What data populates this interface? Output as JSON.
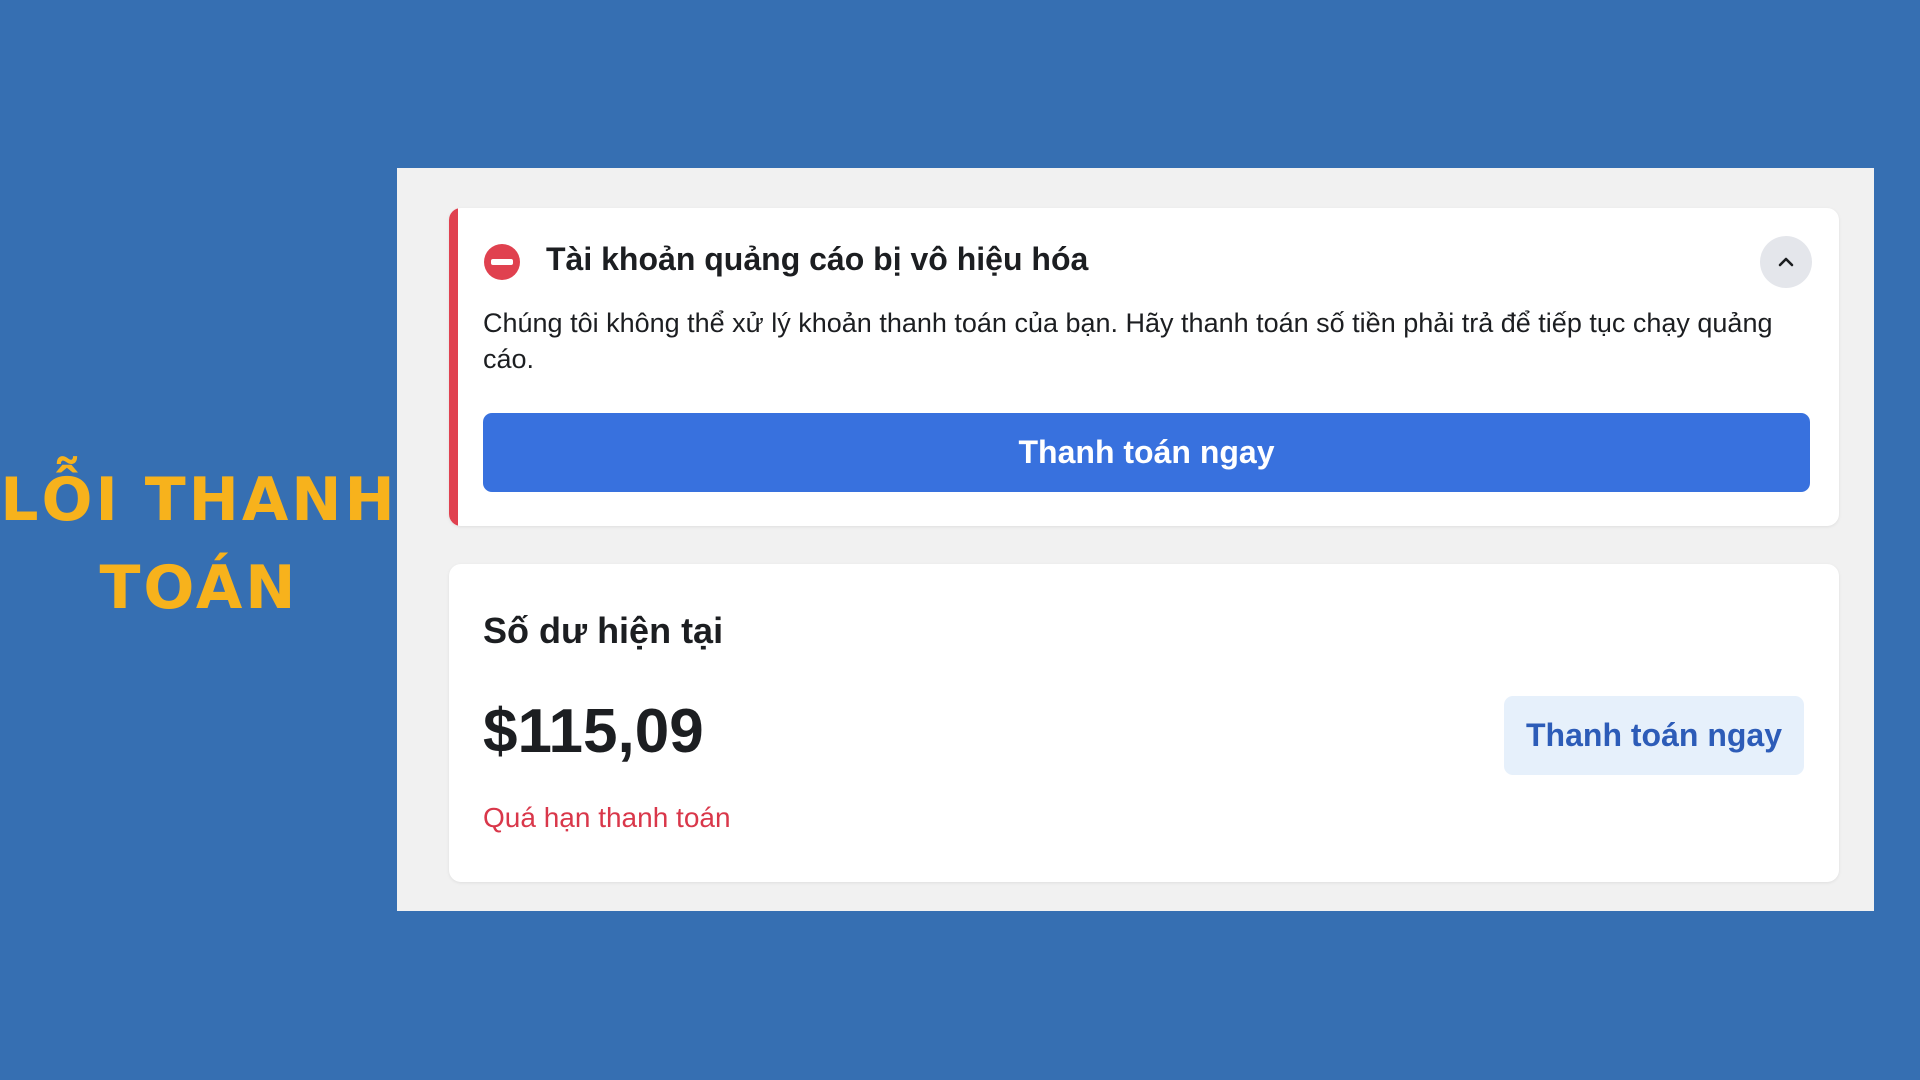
{
  "side_title": "Lỗi thanh toán",
  "alert": {
    "icon": "error-icon",
    "title": "Tài khoản quảng cáo bị vô hiệu hóa",
    "body": "Chúng tôi không thể xử lý khoản thanh toán của bạn. Hãy thanh toán số tiền phải trả để tiếp tục chạy quảng cáo.",
    "pay_button": "Thanh toán ngay",
    "collapse_icon": "chevron-up-icon"
  },
  "balance": {
    "title": "Số dư hiện tại",
    "amount": "$115,09",
    "status": "Quá hạn thanh toán",
    "pay_button": "Thanh toán ngay"
  },
  "colors": {
    "background": "#366fb2",
    "title_yellow": "#f7b21c",
    "error_red": "#e0414f",
    "primary_blue": "#3871de",
    "secondary_bg": "#e6f0fb"
  }
}
